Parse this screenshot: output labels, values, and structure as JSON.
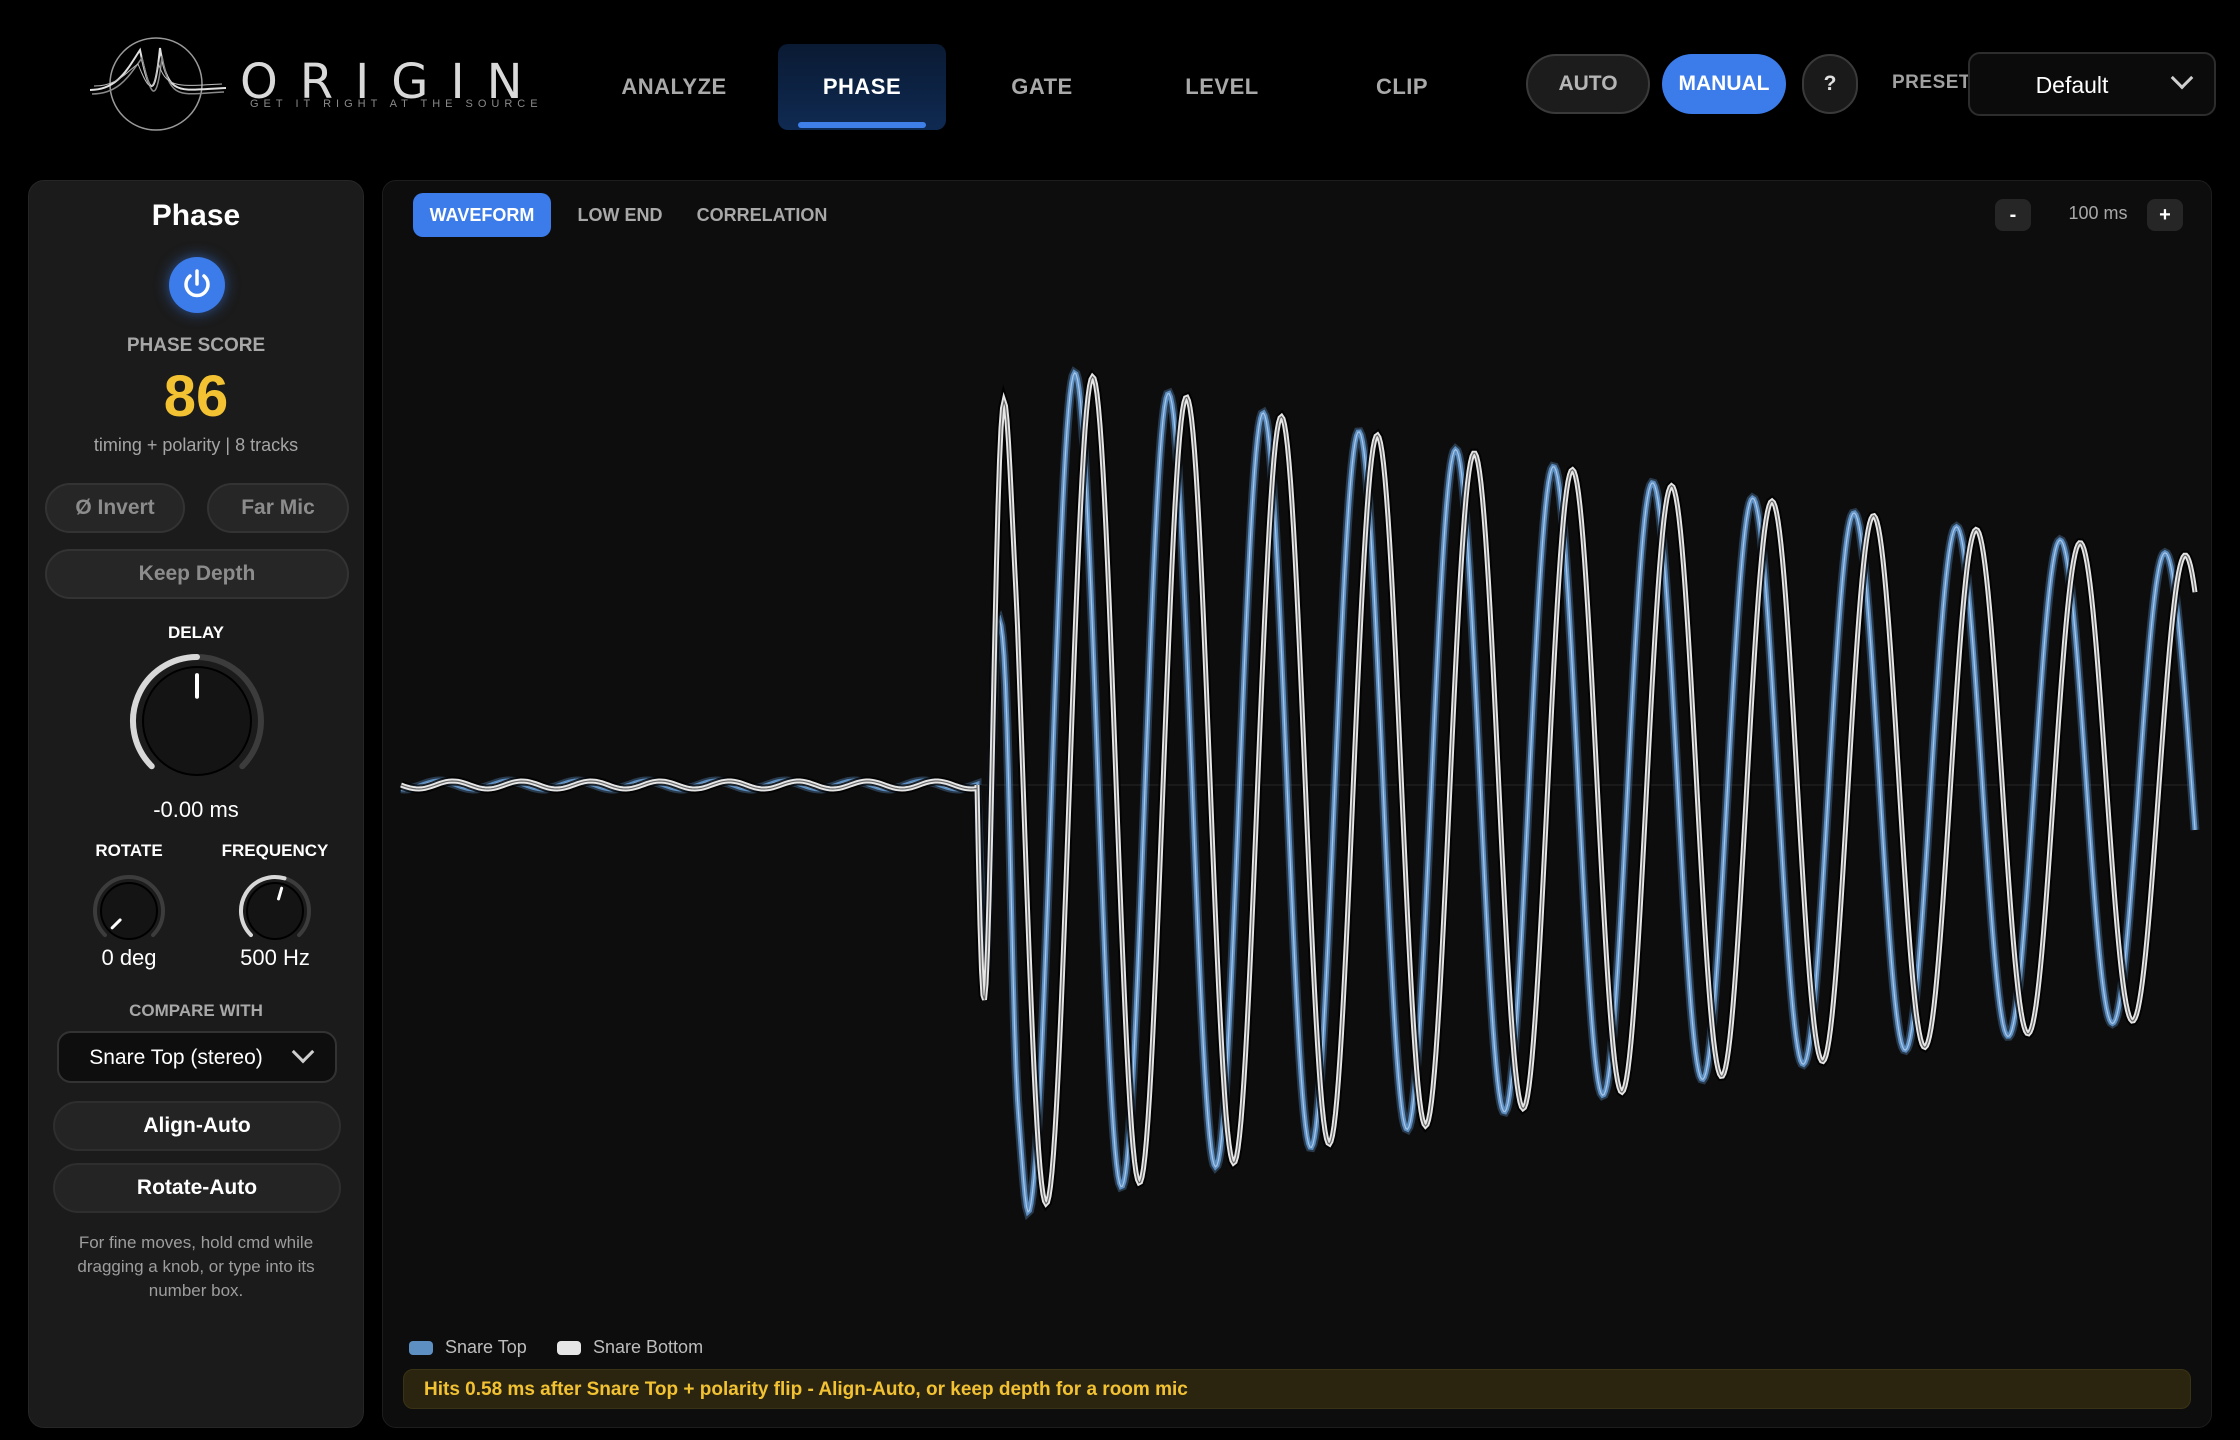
{
  "brand": {
    "name": "ORIGIN",
    "tagline": "GET IT RIGHT AT THE SOURCE"
  },
  "tabs": [
    {
      "label": "ANALYZE",
      "active": false
    },
    {
      "label": "PHASE",
      "active": true
    },
    {
      "label": "GATE",
      "active": false
    },
    {
      "label": "LEVEL",
      "active": false
    },
    {
      "label": "CLIP",
      "active": false
    }
  ],
  "mode": {
    "auto_label": "AUTO",
    "manual_label": "MANUAL",
    "selected": "MANUAL",
    "help_label": "?"
  },
  "preset": {
    "label": "PRESET",
    "value": "Default"
  },
  "phase_panel": {
    "title": "Phase",
    "enabled": true,
    "score_label": "PHASE SCORE",
    "score": "86",
    "score_sub": "timing + polarity  |  8 tracks",
    "invert_label": "Ø Invert",
    "far_mic_label": "Far Mic",
    "keep_depth_label": "Keep Depth",
    "delay_label": "DELAY",
    "delay_value": "-0.00 ms",
    "delay_level": 0.5,
    "rotate_label": "ROTATE",
    "rotate_value": "0 deg",
    "rotate_level": 0.0,
    "frequency_label": "FREQUENCY",
    "frequency_value": "500 Hz",
    "frequency_level": 0.56,
    "compare_label": "COMPARE WITH",
    "compare_value": "Snare Top  (stereo)",
    "align_auto_label": "Align-Auto",
    "rotate_auto_label": "Rotate-Auto",
    "hint": "For fine moves, hold cmd while dragging a knob, or type into its number box."
  },
  "view": {
    "subtabs": [
      {
        "label": "WAVEFORM",
        "active": true
      },
      {
        "label": "LOW END",
        "active": false
      },
      {
        "label": "CORRELATION",
        "active": false
      }
    ],
    "zoom_minus": "-",
    "zoom_value": "100 ms",
    "zoom_plus": "+"
  },
  "legend": [
    {
      "name": "Snare Top",
      "color": "#5d8fc2"
    },
    {
      "name": "Snare Bottom",
      "color": "#e6e6e6"
    }
  ],
  "alert": "Hits 0.58 ms after Snare Top + polarity flip - Align-Auto, or keep depth for a room mic",
  "colors": {
    "accent": "#3b7bea",
    "score": "#f2c233",
    "snare_top": "#5d8fc2",
    "snare_bottom": "#e6e6e6"
  }
}
